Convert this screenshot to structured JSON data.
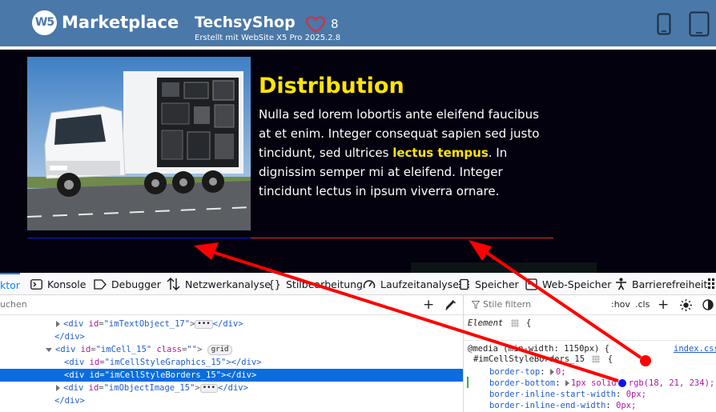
{
  "header": {
    "brand_logo": "W5",
    "brand_name": "Marketplace",
    "site_title": "TechsyShop",
    "site_subtitle": "Erstellt mit WebSite X5 Pro 2025.2.8",
    "favorites_count": "8",
    "icons": [
      "heart-icon",
      "phone-icon",
      "tablet-icon"
    ]
  },
  "site": {
    "heading": "Distribution",
    "text_before": "Nulla sed lorem lobortis ante eleifend faucibus at et enim. Integer consequat sapien sed justo tincidunt, sed ultrices ",
    "text_highlight": "lectus tempus",
    "text_after": ". In dignissim semper mi at eleifend. Integer tincidunt lectus in ipsum viverra ornare.",
    "colors": {
      "background": "#03010e",
      "heading": "#ffe600",
      "border_left": "#1215ea",
      "border_right": "#e02a3a"
    }
  },
  "devtools": {
    "tabs": [
      {
        "label": "ktor",
        "icon": ""
      },
      {
        "label": "Konsole",
        "icon": "console-icon"
      },
      {
        "label": "Debugger",
        "icon": "debugger-icon"
      },
      {
        "label": "Netzwerkanalyse",
        "icon": "network-icon"
      },
      {
        "label": "Stilbearbeitung",
        "icon": "style-editor-icon"
      },
      {
        "label": "Laufzeitanalyse",
        "icon": "performance-icon"
      },
      {
        "label": "Speicher",
        "icon": "memory-icon"
      },
      {
        "label": "Web-Speicher",
        "icon": "storage-icon"
      },
      {
        "label": "Barrierefreiheit",
        "icon": "accessibility-icon"
      }
    ],
    "inspector_search_placeholder": "uchen",
    "rules_filter_placeholder": "Stile filtern",
    "rules_toolbar": {
      "hov": ":hov",
      "cls": ".cls",
      "add": "+"
    },
    "tree": {
      "row1": {
        "tag": "<div",
        "attr": "id",
        "val": "\"imTextObject_17\"",
        "close": "</div>"
      },
      "row2": {
        "text": "</div>"
      },
      "row3": {
        "tag": "<div",
        "attr1": "id",
        "val1": "\"imCell_15\"",
        "attr2": "class",
        "val2": "\"\"",
        "badge": "grid"
      },
      "row4": {
        "tag": "<div",
        "attr": "id",
        "val": "\"imCellStyleGraphics_15\"",
        "close": "></div>"
      },
      "row5": {
        "tag": "<div",
        "attr": "id",
        "val": "\"imCellStyleBorders_15\"",
        "close": "></div>"
      },
      "row6": {
        "tag": "<div",
        "attr": "id",
        "val": "\"imObjectImage_15\"",
        "close": "</div>"
      },
      "row7": {
        "text": "</div>"
      }
    },
    "rules": {
      "element_label": "Element",
      "element_brace": "{",
      "media": "@media (min-width: 1150px) {",
      "source": "index.css",
      "selector": "#imCellStyleBorders_15",
      "selector_brace": "{",
      "decls": [
        {
          "name": "border-top",
          "value": "0;"
        },
        {
          "name": "border-bottom",
          "value": "1px solid",
          "color": "rgb(18, 21, 234);"
        },
        {
          "name": "border-inline-start-width",
          "value": "0px;"
        },
        {
          "name": "border-inline-end-width",
          "value": "0px;"
        }
      ]
    }
  }
}
